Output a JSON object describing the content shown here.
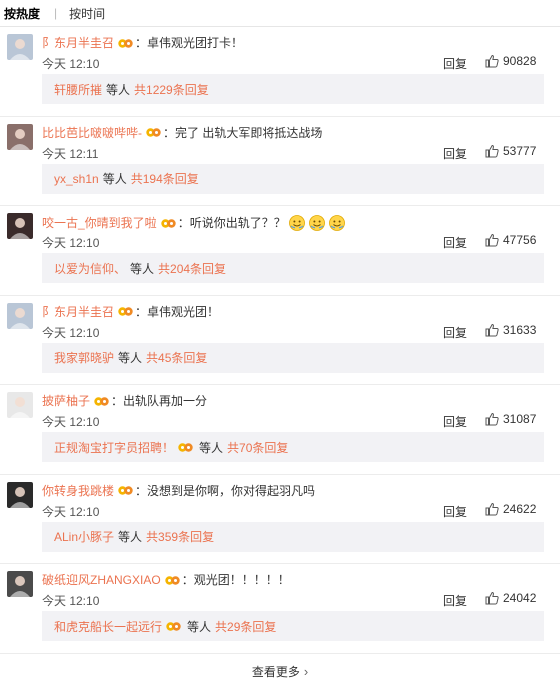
{
  "sort_tabs": [
    {
      "label": "按热度",
      "active": true
    },
    {
      "label": "按时间",
      "active": false
    }
  ],
  "comments": [
    {
      "user": "阝东月半圭召",
      "text": "：卓伟观光团打卡！",
      "time": "今天 12:10",
      "reply_label": "回复",
      "likes": "90828",
      "sub_user": "轩腰所摧",
      "sub_etc": "等人",
      "sub_total": "共1229条回复",
      "avatar_color": "#b9c6d6",
      "emoji_count": 0
    },
    {
      "user": "比比芭比啵啵哔哔-",
      "text": "：完了 出轨大军即将抵达战场",
      "time": "今天 12:11",
      "reply_label": "回复",
      "likes": "53777",
      "sub_user": "yx_sh1n",
      "sub_etc": "等人",
      "sub_total": "共194条回复",
      "avatar_color": "#8a6f6a",
      "emoji_count": 0
    },
    {
      "user": "咬一古_你晴到我了啦",
      "text": "：听说你出轨了？？",
      "time": "今天 12:10",
      "reply_label": "回复",
      "likes": "47756",
      "sub_user": "以爱为信仰、",
      "sub_etc": "等人",
      "sub_total": "共204条回复",
      "avatar_color": "#3a2b2b",
      "emoji_count": 3
    },
    {
      "user": "阝东月半圭召",
      "text": "：卓伟观光团！",
      "time": "今天 12:10",
      "reply_label": "回复",
      "likes": "31633",
      "sub_user": "我家郭晓驴",
      "sub_etc": "等人",
      "sub_total": "共45条回复",
      "avatar_color": "#b9c6d6",
      "emoji_count": 0
    },
    {
      "user": "披萨柚子",
      "text": "：出轨队再加一分",
      "time": "今天 12:10",
      "reply_label": "回复",
      "likes": "31087",
      "sub_user": "正规淘宝打字员招聘！",
      "sub_etc": "等人",
      "sub_total": "共70条回复",
      "avatar_color": "#e8e8e8",
      "emoji_count": 0
    },
    {
      "user": "你转身我跳楼",
      "text": "：没想到是你啊，你对得起羽凡吗",
      "time": "今天 12:10",
      "reply_label": "回复",
      "likes": "24622",
      "sub_user": "ALin小豚子",
      "sub_etc": "等人",
      "sub_total": "共359条回复",
      "avatar_color": "#2a2a2a",
      "emoji_count": 0
    },
    {
      "user": "破纸迎风ZHANGXIAO",
      "text": "：观光团！！！！！",
      "time": "今天 12:10",
      "reply_label": "回复",
      "likes": "24042",
      "sub_user": "和虎克船长一起远行",
      "sub_etc": "等人",
      "sub_total": "共29条回复",
      "avatar_color": "#4b4b4b",
      "emoji_count": 0
    }
  ],
  "more_label": "查看更多",
  "colors": {
    "link": "#eb7350",
    "sub_bg": "#f2f2f5",
    "divider": "#ececec"
  }
}
